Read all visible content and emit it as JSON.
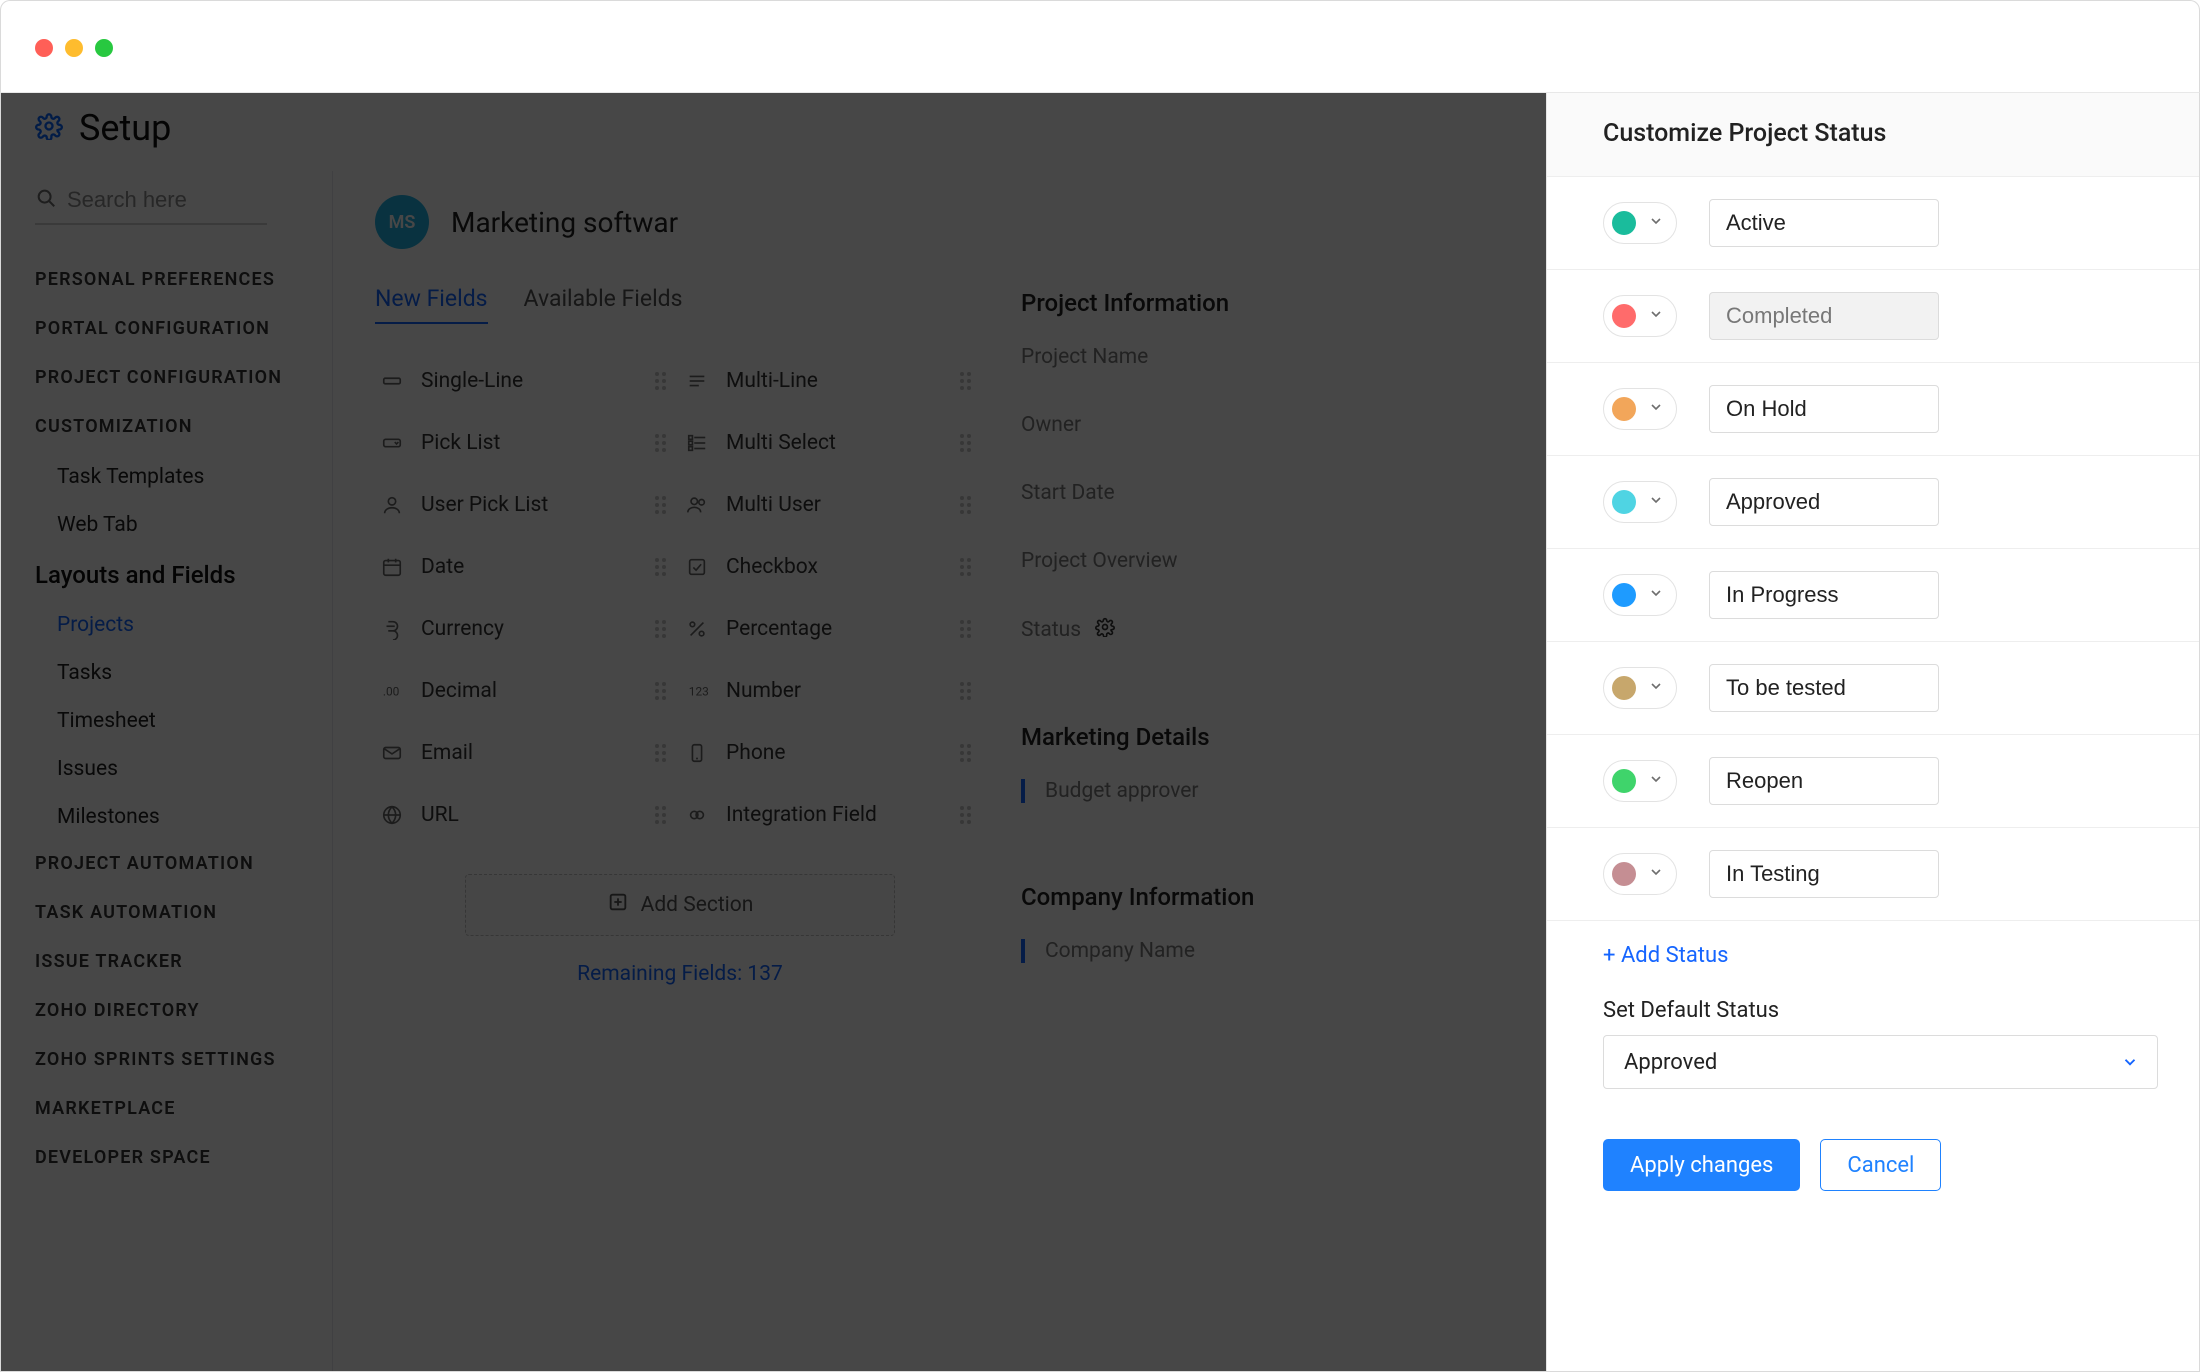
{
  "page": {
    "setup_title": "Setup"
  },
  "search": {
    "placeholder": "Search here"
  },
  "sidebar": {
    "groups_top": [
      {
        "label": "PERSONAL PREFERENCES"
      },
      {
        "label": "PORTAL CONFIGURATION"
      },
      {
        "label": "PROJECT CONFIGURATION"
      }
    ],
    "customization": {
      "label": "CUSTOMIZATION",
      "items": [
        {
          "label": "Task Templates"
        },
        {
          "label": "Web Tab"
        }
      ]
    },
    "layouts": {
      "heading": "Layouts and Fields",
      "items": [
        {
          "label": "Projects",
          "active": true
        },
        {
          "label": "Tasks"
        },
        {
          "label": "Timesheet"
        },
        {
          "label": "Issues"
        },
        {
          "label": "Milestones"
        }
      ]
    },
    "groups_bottom": [
      {
        "label": "PROJECT AUTOMATION"
      },
      {
        "label": "TASK AUTOMATION"
      },
      {
        "label": "ISSUE TRACKER"
      },
      {
        "label": "ZOHO DIRECTORY"
      },
      {
        "label": "ZOHO SPRINTS SETTINGS"
      },
      {
        "label": "MARKETPLACE"
      },
      {
        "label": "DEVELOPER SPACE"
      }
    ]
  },
  "project": {
    "avatar_initials": "MS",
    "name": "Marketing softwar"
  },
  "tabs": {
    "new_fields": "New Fields",
    "available_fields": "Available Fields"
  },
  "fields_grid": [
    {
      "a": "Single-Line",
      "a_icon": "single-line",
      "b": "Multi-Line",
      "b_icon": "multi-line"
    },
    {
      "a": "Pick List",
      "a_icon": "pick-list",
      "b": "Multi Select",
      "b_icon": "multi-select"
    },
    {
      "a": "User Pick List",
      "a_icon": "user-pick-list",
      "b": "Multi User",
      "b_icon": "multi-user"
    },
    {
      "a": "Date",
      "a_icon": "date",
      "b": "Checkbox",
      "b_icon": "checkbox"
    },
    {
      "a": "Currency",
      "a_icon": "currency",
      "b": "Percentage",
      "b_icon": "percentage"
    },
    {
      "a": "Decimal",
      "a_icon": "decimal",
      "b": "Number",
      "b_icon": "number"
    },
    {
      "a": "Email",
      "a_icon": "email",
      "b": "Phone",
      "b_icon": "phone"
    },
    {
      "a": "URL",
      "a_icon": "url",
      "b": "Integration Field",
      "b_icon": "integration"
    }
  ],
  "add_section_label": "Add Section",
  "remaining_fields": {
    "label_prefix": "Remaining Fields: ",
    "count": "137"
  },
  "project_info": {
    "title": "Project Information",
    "fields": [
      {
        "label": "Project Name"
      },
      {
        "label": "Owner"
      },
      {
        "label": "Start Date"
      },
      {
        "label": "Project Overview"
      }
    ],
    "status_label": "Status"
  },
  "marketing_details": {
    "title": "Marketing Details",
    "field": "Budget approver"
  },
  "company_info": {
    "title": "Company Information",
    "field": "Company Name"
  },
  "panel": {
    "title": "Customize Project Status",
    "statuses": [
      {
        "label": "Active",
        "color": "#1abc9c",
        "readonly": false
      },
      {
        "label": "Completed",
        "color": "#ff6b6b",
        "readonly": true
      },
      {
        "label": "On Hold",
        "color": "#f2a65a",
        "readonly": false
      },
      {
        "label": "Approved",
        "color": "#4fd4e3",
        "readonly": false
      },
      {
        "label": "In Progress",
        "color": "#1e9bff",
        "readonly": false
      },
      {
        "label": "To be tested",
        "color": "#c7a76c",
        "readonly": false
      },
      {
        "label": "Reopen",
        "color": "#3fd46b",
        "readonly": false
      },
      {
        "label": "In Testing",
        "color": "#c58e93",
        "readonly": false
      }
    ],
    "add_status_label": "+ Add Status",
    "default_label": "Set Default Status",
    "default_value": "Approved",
    "apply_label": "Apply changes",
    "cancel_label": "Cancel"
  }
}
